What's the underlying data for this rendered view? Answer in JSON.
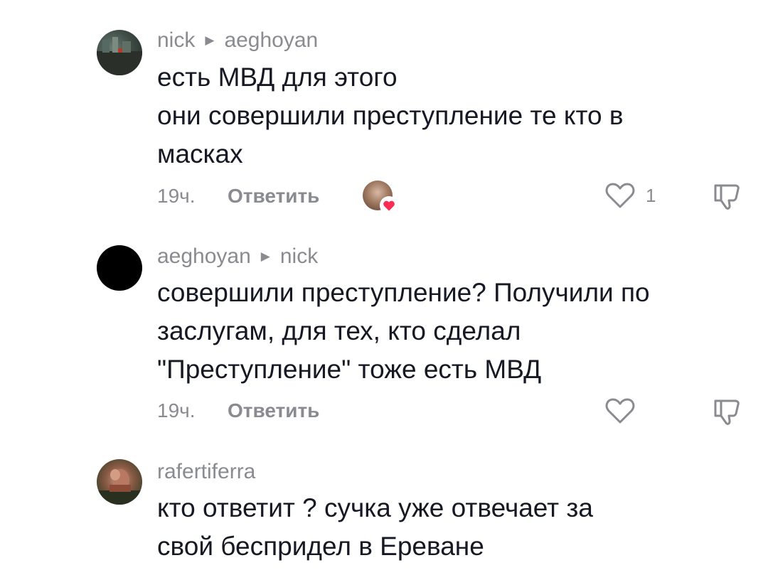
{
  "comments": [
    {
      "author": "nick",
      "reply_to": "aeghoyan",
      "lines": [
        "есть МВД для этого",
        "они совершили преступление те кто в",
        "масках"
      ],
      "time": "19ч.",
      "reply_label": "Ответить",
      "like_count": "1",
      "creator_liked": true
    },
    {
      "author": "aeghoyan",
      "reply_to": "nick",
      "lines": [
        "совершили преступление? Получили по",
        "заслугам, для тех, кто сделал",
        "\"Преступление\" тоже есть МВД"
      ],
      "time": "19ч.",
      "reply_label": "Ответить",
      "like_count": "",
      "creator_liked": false
    },
    {
      "author": "rafertiferra",
      "reply_to": "",
      "lines": [
        "кто ответит ? сучка уже отвечает за",
        "свой беспридел в Ереване"
      ]
    }
  ],
  "icons": {
    "like": "heart-outline-icon",
    "dislike": "thumbs-down-icon",
    "reply_arrow": "triangle-right-icon",
    "creator_heart": "heart-filled-icon"
  },
  "colors": {
    "text": "#161823",
    "muted": "#8a8b91",
    "heart": "#fe2c55"
  }
}
